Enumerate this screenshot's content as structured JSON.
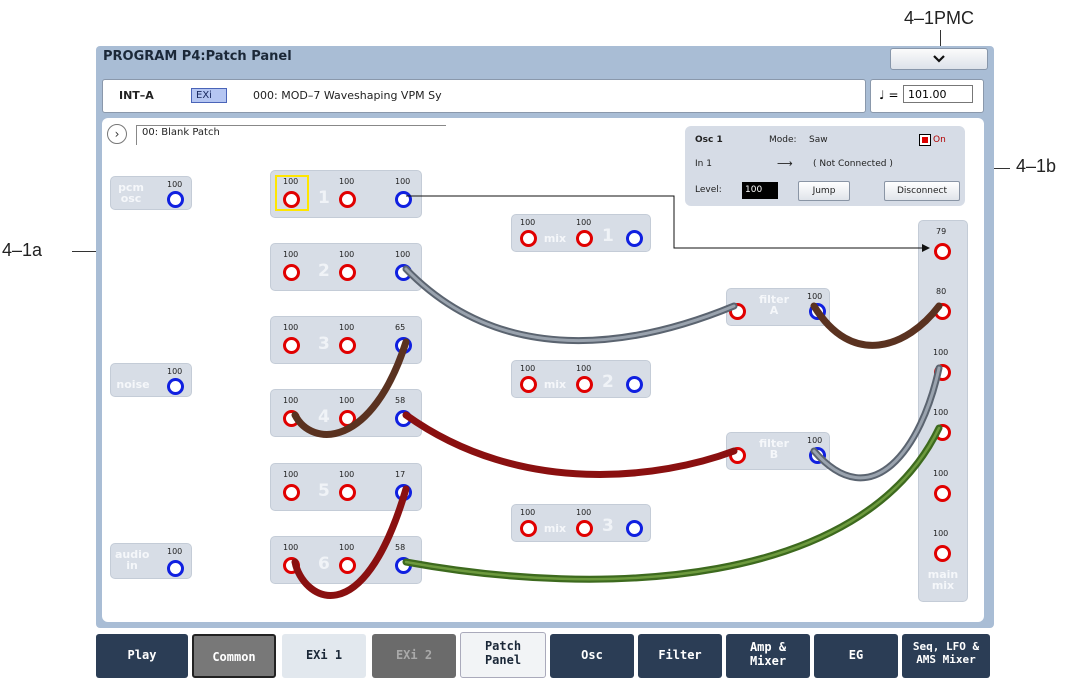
{
  "callouts": {
    "pmc": "4–1PMC",
    "b": "4–1b",
    "a": "4–1a"
  },
  "window": {
    "title": "PROGRAM P4:Patch Panel",
    "menu_icon": "chevron-down-icon"
  },
  "program": {
    "bank": "INT–A",
    "type": "EXi",
    "name": "000: MOD–7 Waveshaping VPM Sy",
    "tempo_symbol": "♩ =",
    "tempo": "101.00"
  },
  "patch": {
    "name": "00: Blank Patch"
  },
  "sources": {
    "pcm": {
      "name_line1": "pcm",
      "name_line2": "osc",
      "level": "100"
    },
    "noise": {
      "name": "noise",
      "level": "100"
    },
    "audio": {
      "name_line1": "audio",
      "name_line2": "in",
      "level": "100"
    }
  },
  "oscillators": [
    {
      "number": "1",
      "levels": [
        "100",
        "100",
        "100"
      ]
    },
    {
      "number": "2",
      "levels": [
        "100",
        "100",
        "100"
      ]
    },
    {
      "number": "3",
      "levels": [
        "100",
        "100",
        "65"
      ]
    },
    {
      "number": "4",
      "levels": [
        "100",
        "100",
        "58"
      ]
    },
    {
      "number": "5",
      "levels": [
        "100",
        "100",
        "17"
      ]
    },
    {
      "number": "6",
      "levels": [
        "100",
        "100",
        "58"
      ]
    }
  ],
  "mixers": [
    {
      "name": "mix",
      "number": "1",
      "levels": [
        "100",
        "100"
      ]
    },
    {
      "name": "mix",
      "number": "2",
      "levels": [
        "100",
        "100"
      ]
    },
    {
      "name": "mix",
      "number": "3",
      "levels": [
        "100",
        "100"
      ]
    }
  ],
  "filters": [
    {
      "name_line1": "filter",
      "name_line2": "A",
      "level": "100"
    },
    {
      "name_line1": "filter",
      "name_line2": "B",
      "level": "100"
    }
  ],
  "main_mix": {
    "name_line1": "main",
    "name_line2": "mix",
    "levels": [
      "79",
      "80",
      "100",
      "100",
      "100",
      "100"
    ]
  },
  "osc_panel": {
    "title": "Osc 1",
    "mode_label": "Mode:",
    "mode_value": "Saw",
    "on_label": "On",
    "input_label": "In 1",
    "arrow": "⟶",
    "connection": "( Not Connected )",
    "level_label": "Level:",
    "level_value": "100",
    "jump_label": "Jump",
    "disconnect_label": "Disconnect"
  },
  "tabs": [
    {
      "label_line1": "Play",
      "label_line2": "",
      "state": "dark"
    },
    {
      "label_line1": "Common",
      "label_line2": "",
      "state": "grey"
    },
    {
      "label_line1": "EXi 1",
      "label_line2": "",
      "state": "light"
    },
    {
      "label_line1": "EXi 2",
      "label_line2": "",
      "state": "dim"
    },
    {
      "label_line1": "Patch",
      "label_line2": "Panel",
      "state": "selected"
    },
    {
      "label_line1": "Osc",
      "label_line2": "",
      "state": "dark"
    },
    {
      "label_line1": "Filter",
      "label_line2": "",
      "state": "dark"
    },
    {
      "label_line1": "Amp &",
      "label_line2": "Mixer",
      "state": "dark"
    },
    {
      "label_line1": "EG",
      "label_line2": "",
      "state": "dark"
    },
    {
      "label_line1": "Seq, LFO &",
      "label_line2": "AMS Mixer",
      "state": "dark"
    }
  ],
  "colors": {
    "screen_bg": "#a9bdd5",
    "module_bg": "#d7dde6",
    "input_jack": "#e00000",
    "output_jack": "#1020e0",
    "cable_grey": "#707c8c",
    "cable_brown": "#5a3220",
    "cable_red": "#8a1010",
    "cable_green": "#3d6a1e",
    "selection": "#ffe600"
  }
}
